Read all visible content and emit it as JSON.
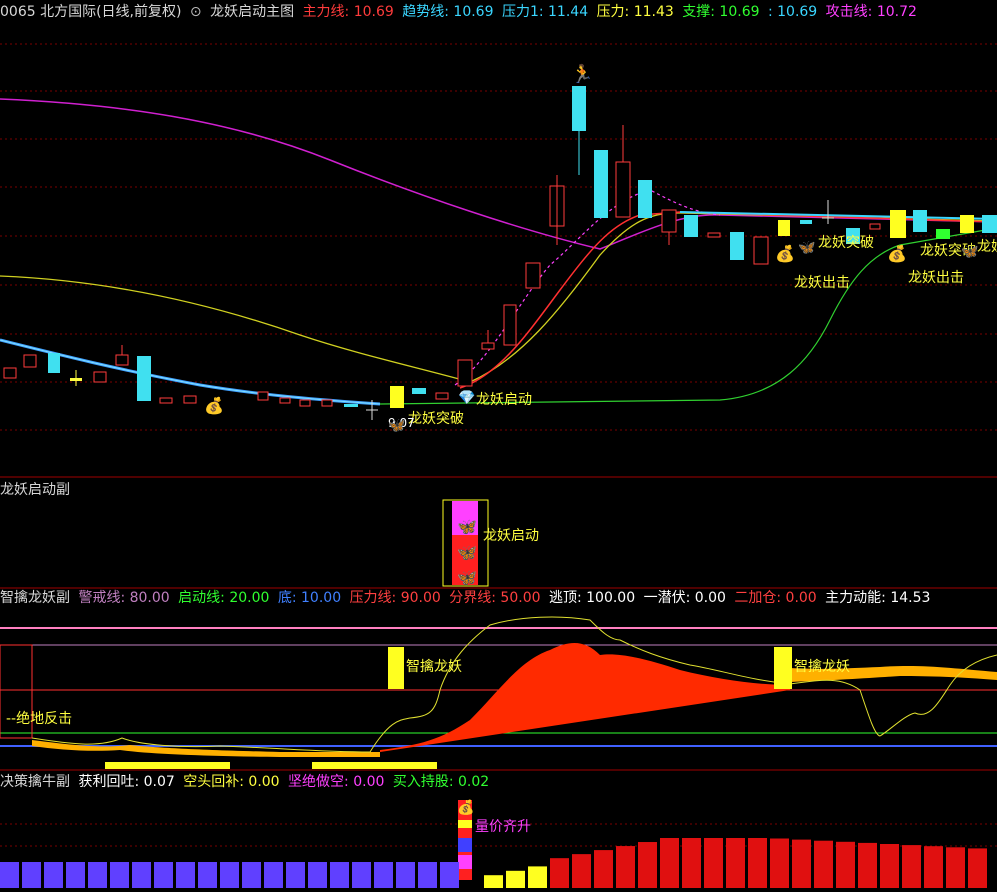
{
  "main_header": {
    "symbol": "0065 北方国际(日线,前复权)",
    "indicator": "龙妖启动主图",
    "items": [
      {
        "label": "主力线: 10.69",
        "color": "#ff3b3b"
      },
      {
        "label": "趋势线: 10.69",
        "color": "#3ad6ff"
      },
      {
        "label": "压力1: 11.44",
        "color": "#3ad6ff"
      },
      {
        "label": "压力: 11.43",
        "color": "#ffff40"
      },
      {
        "label": "支撑: 10.69",
        "color": "#30ff30"
      },
      {
        "label": ": 10.69",
        "color": "#3ad6ff"
      },
      {
        "label": "攻击线: 10.72",
        "color": "#ff40ff"
      }
    ]
  },
  "main_chart_labels": {
    "breakout1": "龙妖突破",
    "start1": "龙妖启动",
    "breakout2": "龙妖突破",
    "breakout3": "龙妖突破",
    "out1": "龙妖出击",
    "out2": "龙妖出击",
    "low_price": "9.07",
    "breakout_partial": "龙妖"
  },
  "panel2": {
    "title": "龙妖启动副",
    "signal_label": "龙妖启动"
  },
  "panel3": {
    "title": "智擒龙妖副",
    "items": [
      {
        "label": "警戒线: 80.00",
        "color": "#c080c0"
      },
      {
        "label": "启动线: 20.00",
        "color": "#30ff30"
      },
      {
        "label": "底: 10.00",
        "color": "#4080ff"
      },
      {
        "label": "压力线: 90.00",
        "color": "#ff4040"
      },
      {
        "label": "分界线: 50.00",
        "color": "#ff4040"
      },
      {
        "label": "逃顶: 100.00",
        "color": "#ffffff"
      },
      {
        "label": "一潜伏: 0.00",
        "color": "#ffffff"
      },
      {
        "label": "二加仓: 0.00",
        "color": "#ff4040"
      },
      {
        "label": "主力动能: 14.53",
        "color": "#ffffff"
      }
    ],
    "signal1": "智擒龙妖",
    "signal2": "智擒龙妖",
    "bottom_label": "--绝地反击"
  },
  "panel4": {
    "title": "决策擒牛副",
    "items": [
      {
        "label": "获利回吐: 0.07",
        "color": "#ffffff"
      },
      {
        "label": "空头回补: 0.00",
        "color": "#ffff40"
      },
      {
        "label": "坚绝做空: 0.00",
        "color": "#ff40ff"
      },
      {
        "label": "买入持股: 0.02",
        "color": "#30ff30"
      }
    ],
    "signal": "量价齐升"
  }
}
